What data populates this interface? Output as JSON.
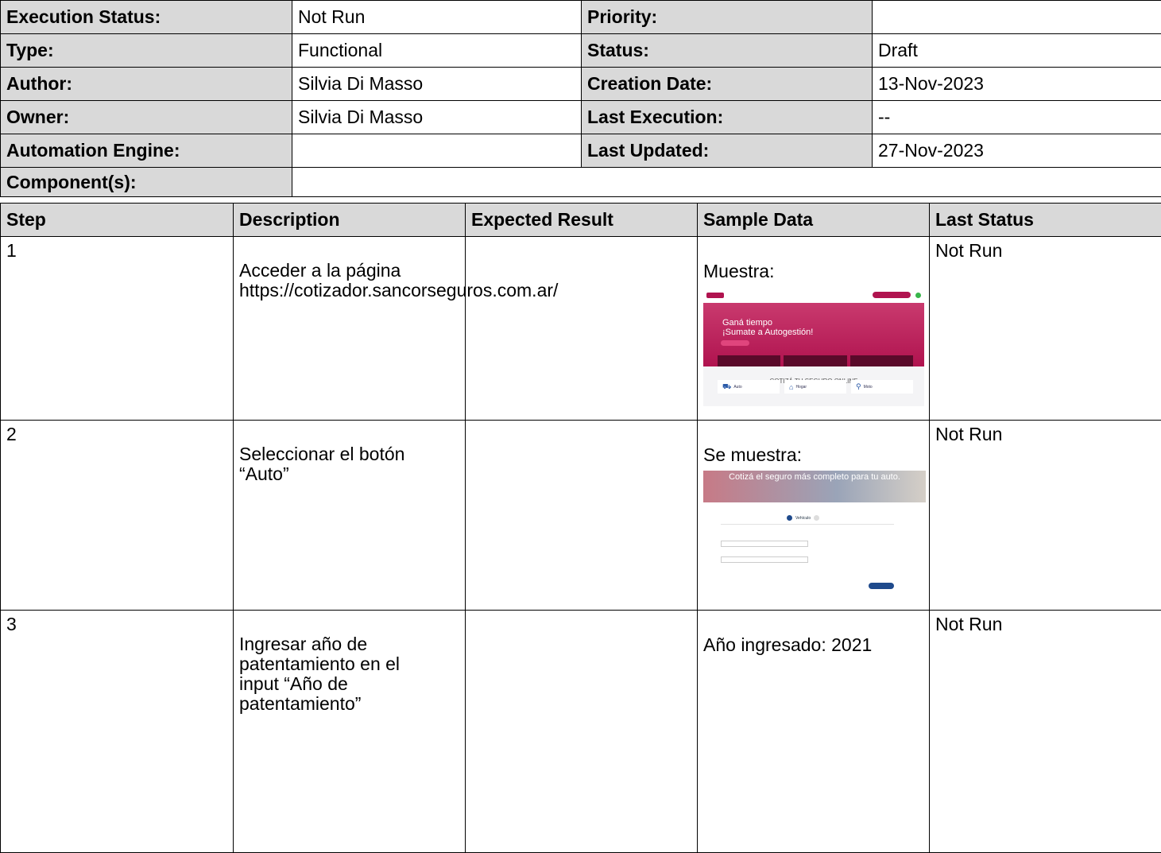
{
  "meta": {
    "execution_status_label": "Execution Status:",
    "execution_status_value": "Not Run",
    "priority_label": "Priority:",
    "priority_value": "",
    "type_label": "Type:",
    "type_value": "Functional",
    "status_label": "Status:",
    "status_value": "Draft",
    "author_label": "Author:",
    "author_value": "Silvia Di Masso",
    "creation_date_label": "Creation Date:",
    "creation_date_value": "13-Nov-2023",
    "owner_label": "Owner:",
    "owner_value": "Silvia Di Masso",
    "last_execution_label": "Last Execution:",
    "last_execution_value": "--",
    "automation_engine_label": "Automation Engine:",
    "automation_engine_value": "",
    "last_updated_label": "Last Updated:",
    "last_updated_value": "27-Nov-2023",
    "components_label": "Component(s):",
    "components_value": ""
  },
  "steps_table": {
    "headers": [
      "Step",
      "Description",
      "Expected Result",
      "Sample Data",
      "Last Status"
    ],
    "rows": [
      {
        "step": "1",
        "description_line1": "Acceder a la página",
        "description_line2": "https://cotizador.sancorseguros.com.ar/",
        "expected": "",
        "sample_caption": "Muestra:",
        "last_status": "Not Run"
      },
      {
        "step": "2",
        "description_line1": "Seleccionar el botón",
        "description_line2": "“Auto”",
        "expected": "",
        "sample_caption": "Se muestra:",
        "last_status": "Not Run"
      },
      {
        "step": "3",
        "description_line1": "Ingresar año de",
        "description_line2": "patentamiento en el",
        "description_line3": "input “Año de",
        "description_line4": "patentamiento”",
        "expected": "",
        "sample_caption": "Año ingresado: 2021",
        "last_status": "Not Run"
      }
    ]
  },
  "screenshot1": {
    "hero_line1": "Ganá tiempo",
    "hero_line2": "¡Sumate a Autogestión!",
    "cta_title": "COTIZÁ TU SEGURO ONLINE",
    "card1": "Auto",
    "card2": "Hogar",
    "card3": "Moto"
  },
  "screenshot2": {
    "hero_text": "Cotizá el seguro más completo para tu auto.",
    "step1": "Vehículo"
  },
  "colors": {
    "label_bg": "#d9d9d9",
    "brand_magenta": "#b0134f",
    "brand_blue": "#1f4a8c"
  }
}
